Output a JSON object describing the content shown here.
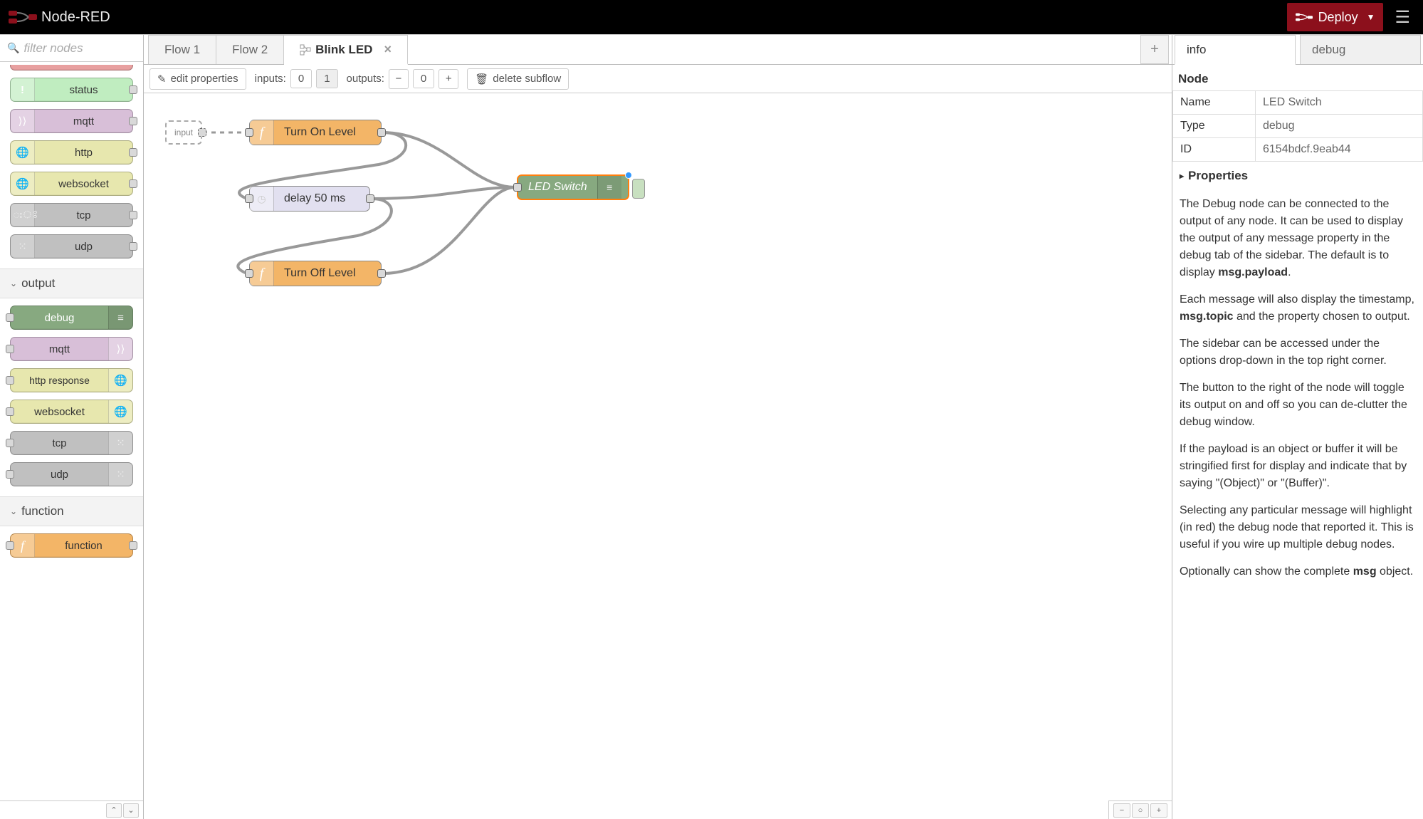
{
  "header": {
    "app_title": "Node-RED",
    "deploy_label": "Deploy"
  },
  "palette": {
    "filter_placeholder": "filter nodes",
    "visible_input_nodes": [
      {
        "label": "status",
        "color": "#c0edc0",
        "icon": "alert"
      },
      {
        "label": "mqtt",
        "color": "#d8bfd8",
        "icon": "mqtt"
      },
      {
        "label": "http",
        "color": "#e7e7ae",
        "icon": "globe"
      },
      {
        "label": "websocket",
        "color": "#e7e7ae",
        "icon": "globe"
      },
      {
        "label": "tcp",
        "color": "#c0c0c0",
        "icon": "net"
      },
      {
        "label": "udp",
        "color": "#c0c0c0",
        "icon": "net"
      }
    ],
    "categories": [
      {
        "name": "output",
        "expanded": true,
        "nodes": [
          {
            "label": "debug",
            "color": "#87a980",
            "icon": "debug",
            "icon_side": "right"
          },
          {
            "label": "mqtt",
            "color": "#d8bfd8",
            "icon": "mqtt",
            "icon_side": "right"
          },
          {
            "label": "http response",
            "color": "#e7e7ae",
            "icon": "globe",
            "icon_side": "right"
          },
          {
            "label": "websocket",
            "color": "#e7e7ae",
            "icon": "globe",
            "icon_side": "right"
          },
          {
            "label": "tcp",
            "color": "#c0c0c0",
            "icon": "net",
            "icon_side": "right"
          },
          {
            "label": "udp",
            "color": "#c0c0c0",
            "icon": "net",
            "icon_side": "right"
          }
        ]
      },
      {
        "name": "function",
        "expanded": true,
        "nodes": [
          {
            "label": "function",
            "color": "#f3b567",
            "icon": "function",
            "icon_side": "left"
          }
        ]
      }
    ]
  },
  "workspace": {
    "tabs": [
      {
        "label": "Flow 1",
        "active": false,
        "subflow": false
      },
      {
        "label": "Flow 2",
        "active": false,
        "subflow": false
      },
      {
        "label": "Blink LED",
        "active": true,
        "subflow": true,
        "closeable": true
      }
    ],
    "subflow_toolbar": {
      "edit_properties": "edit properties",
      "inputs_label": "inputs:",
      "inputs_options": [
        "0",
        "1"
      ],
      "inputs_selected": "1",
      "outputs_label": "outputs:",
      "outputs_value": "0",
      "delete_subflow": "delete subflow"
    },
    "flow_nodes": {
      "input_port": {
        "label": "input"
      },
      "turn_on": {
        "label": "Turn On Level"
      },
      "delay": {
        "label": "delay 50 ms"
      },
      "turn_off": {
        "label": "Turn Off Level"
      },
      "led_switch": {
        "label": "LED Switch"
      }
    }
  },
  "sidebar": {
    "tabs": [
      {
        "label": "info",
        "active": true
      },
      {
        "label": "debug",
        "active": false
      }
    ],
    "section_title": "Node",
    "node_table": {
      "name_label": "Name",
      "name_value": "LED Switch",
      "type_label": "Type",
      "type_value": "debug",
      "id_label": "ID",
      "id_value": "6154bdcf.9eab44"
    },
    "properties_label": "Properties",
    "help": {
      "p1a": "The Debug node can be connected to the output of any node. It can be used to display the output of any message property in the debug tab of the sidebar. The default is to display ",
      "p1b": "msg.payload",
      "p1c": ".",
      "p2a": "Each message will also display the timestamp, ",
      "p2b": "msg.topic",
      "p2c": " and the property chosen to output.",
      "p3": "The sidebar can be accessed under the options drop-down in the top right corner.",
      "p4": "The button to the right of the node will toggle its output on and off so you can de-clutter the debug window.",
      "p5": "If the payload is an object or buffer it will be stringified first for display and indicate that by saying \"(Object)\" or \"(Buffer)\".",
      "p6": "Selecting any particular message will highlight (in red) the debug node that reported it. This is useful if you wire up multiple debug nodes.",
      "p7a": "Optionally can show the complete ",
      "p7b": "msg",
      "p7c": " object."
    }
  }
}
